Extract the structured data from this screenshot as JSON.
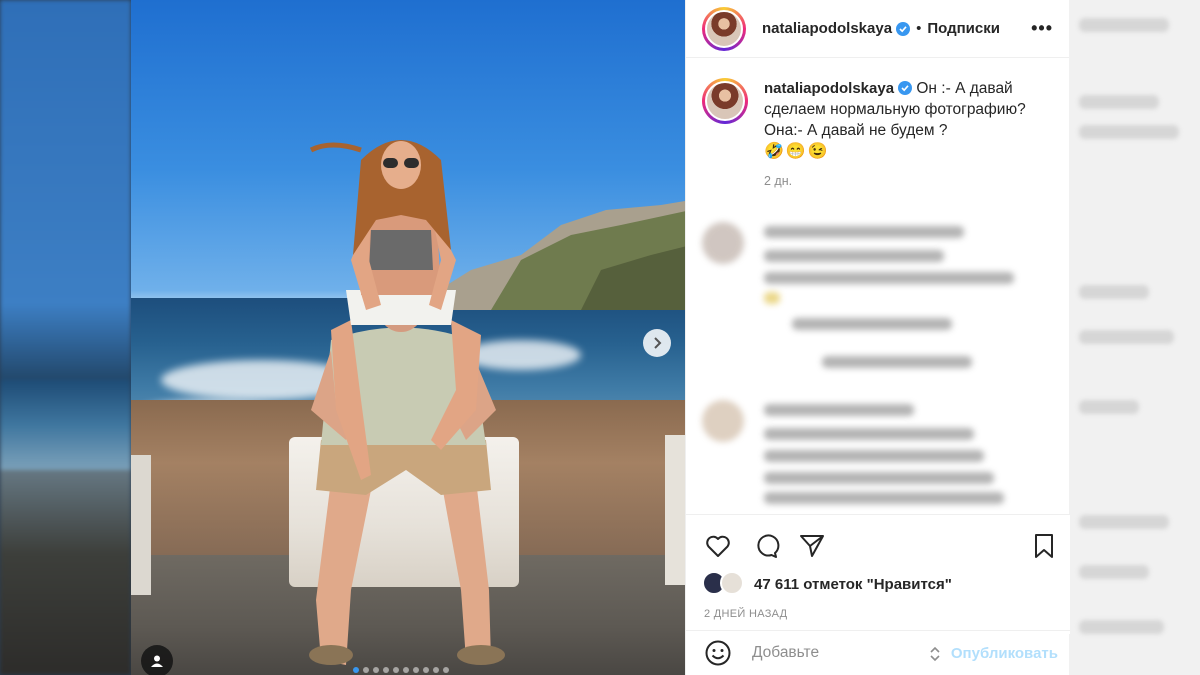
{
  "post": {
    "username": "nataliapodolskaya",
    "verified": true,
    "follow_label": "Подписки",
    "separator": "•",
    "more_label": "•••"
  },
  "caption": {
    "username": "nataliapodolskaya",
    "line1": "Он :- А давай сделаем нормальную фотографию?",
    "line2": "Она:- А давай не будем ?",
    "emojis": "🤣😁😉",
    "time": "2 дн."
  },
  "likes": {
    "count_text": "47 611 отметок \"Нравится\""
  },
  "posted_ago": "2 ДНЕЙ НАЗАД",
  "comment_input": {
    "placeholder": "Добавьте"
  },
  "publish_label": "Опубликовать",
  "carousel": {
    "total": 10,
    "active_index": 0
  },
  "colors": {
    "verified": "#3897f0",
    "publish": "#b2dffc",
    "text": "#262626",
    "muted": "#8e8e8e"
  }
}
